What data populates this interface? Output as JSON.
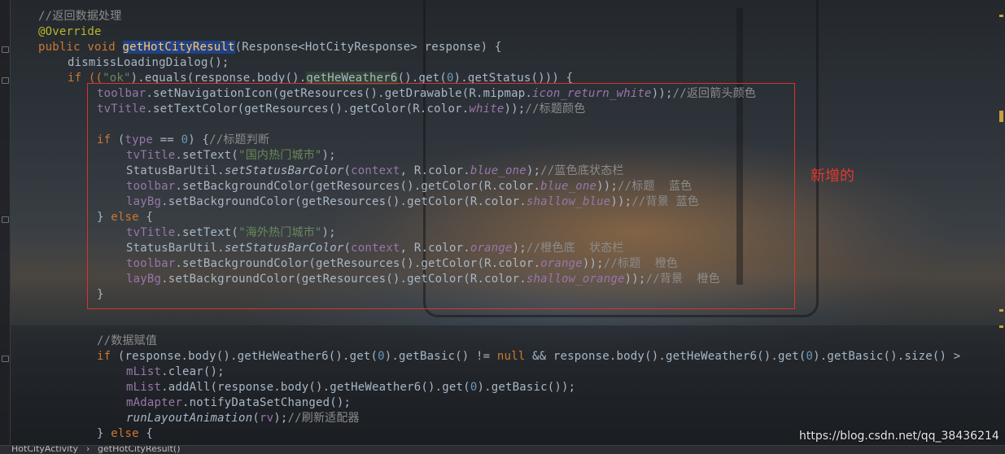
{
  "editor": {
    "lines": {
      "l1": "//返回数据处理",
      "l2": "@Override",
      "l3a": "public void ",
      "l3b": "getHotCityResult",
      "l3c": "(Response<HotCityResponse> response) {",
      "l4": "dismissLoadingDialog();",
      "l5a": "if ((",
      "l5b": "\"ok\"",
      "l5c": ").equals(response.body().",
      "l5d": "getHeWeather6",
      "l5e": "().get(",
      "l5f": "0",
      "l5g": ").getStatus())) {",
      "l6a": "toolbar",
      "l6b": ".setNavigationIcon(getResources().getDrawable(R.mipmap.",
      "l6c": "icon_return_white",
      "l6d": "));",
      "l6e": "//返回箭头颜色",
      "l7a": "tvTitle",
      "l7b": ".setTextColor(getResources().getColor(R.color.",
      "l7c": "white",
      "l7d": "));",
      "l7e": "//标题颜色",
      "l8a": "if ",
      "l8b": "(",
      "l8c": "type",
      "l8d": " == ",
      "l8e": "0",
      "l8f": ") {",
      "l8g": "//标题判断",
      "l9a": "tvTitle",
      "l9b": ".setText(",
      "l9c": "\"国内热门城市\"",
      "l9d": ");",
      "l10a": "StatusBarUtil.",
      "l10b": "setStatusBarColor",
      "l10c": "(",
      "l10d": "context",
      "l10e": ", R.color.",
      "l10f": "blue_one",
      "l10g": ");",
      "l10h": "//蓝色底状态栏",
      "l11a": "toolbar",
      "l11b": ".setBackgroundColor(getResources().getColor(R.color.",
      "l11c": "blue_one",
      "l11d": "));",
      "l11e": "//标题  蓝色",
      "l12a": "layBg",
      "l12b": ".setBackgroundColor(getResources().getColor(R.color.",
      "l12c": "shallow_blue",
      "l12d": "));",
      "l12e": "//背景 蓝色",
      "l13a": "} ",
      "l13b": "else",
      "l13c": " {",
      "l14a": "tvTitle",
      "l14b": ".setText(",
      "l14c": "\"海外热门城市\"",
      "l14d": ");",
      "l15a": "StatusBarUtil.",
      "l15b": "setStatusBarColor",
      "l15c": "(",
      "l15d": "context",
      "l15e": ", R.color.",
      "l15f": "orange",
      "l15g": ");",
      "l15h": "//橙色底  状态栏",
      "l16a": "toolbar",
      "l16b": ".setBackgroundColor(getResources().getColor(R.color.",
      "l16c": "orange",
      "l16d": "));",
      "l16e": "//标题  橙色",
      "l17a": "layBg",
      "l17b": ".setBackgroundColor(getResources().getColor(R.color.",
      "l17c": "shallow_orange",
      "l17d": "));",
      "l17e": "//背景  橙色",
      "l18": "}",
      "l19": "//数据赋值",
      "l20a": "if ",
      "l20b": "(response.body().getHeWeather6().get(",
      "l20c": "0",
      "l20d": ").getBasic() != ",
      "l20e": "null",
      "l20f": " && response.body().getHeWeather6().get(",
      "l20g": "0",
      "l20h": ").getBasic().size() >",
      "l21a": "mList",
      "l21b": ".clear();",
      "l22a": "mList",
      "l22b": ".addAll(response.body().getHeWeather6().get(",
      "l22c": "0",
      "l22d": ").getBasic());",
      "l23a": "mAdapter",
      "l23b": ".notifyDataSetChanged();",
      "l24a": "runLayoutAnimation",
      "l24b": "(",
      "l24c": "rv",
      "l24d": ");",
      "l24e": "//刷新适配器",
      "l25a": "} ",
      "l25b": "else",
      "l25c": " {"
    }
  },
  "annotation": {
    "note": "新增的"
  },
  "watermark": "https://blog.csdn.net/qq_38436214",
  "breadcrumb": {
    "class_name": "HotCityActivity",
    "separator": "›",
    "method_name": "getHotCityResult()"
  },
  "colors": {
    "keyword": "#cc7832",
    "string": "#6a8759",
    "number": "#6897bb",
    "field": "#9876aa",
    "comment": "#8c8c8c",
    "annotation_box": "#d9342b"
  }
}
